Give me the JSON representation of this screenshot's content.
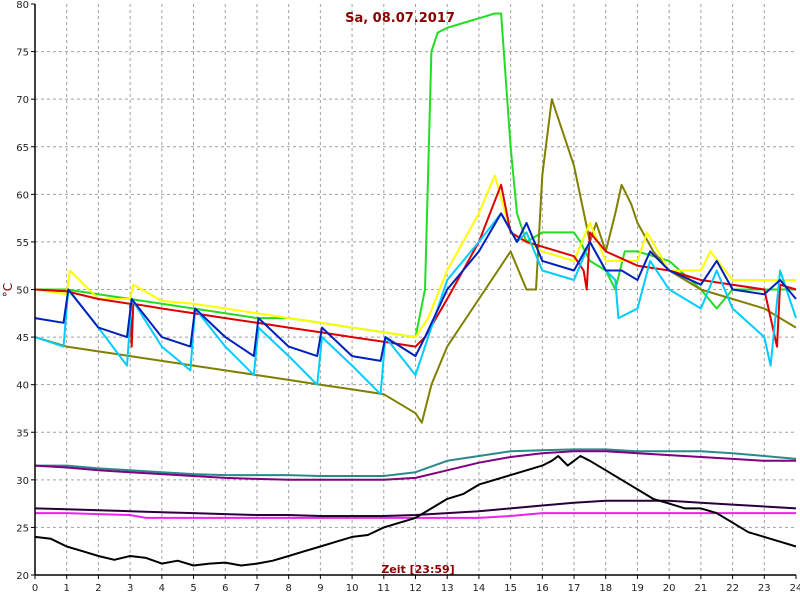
{
  "chart_data": {
    "type": "line",
    "title": "Sa, 08.07.2017",
    "xlabel": "Zeit [23:59]",
    "ylabel": "°C",
    "xlim": [
      0,
      24
    ],
    "ylim": [
      20,
      80
    ],
    "x_ticks": [
      0,
      1,
      2,
      3,
      4,
      5,
      6,
      7,
      8,
      9,
      10,
      11,
      12,
      13,
      14,
      15,
      16,
      17,
      18,
      19,
      20,
      21,
      22,
      23,
      24
    ],
    "y_ticks": [
      20,
      25,
      30,
      35,
      40,
      45,
      50,
      55,
      60,
      65,
      70,
      75,
      80
    ],
    "grid": true,
    "grid_style": "dashed",
    "legend": "none",
    "colors": {
      "background": "#ffffff",
      "grid": "#a0a0a0",
      "axis": "#000000",
      "title": "#8b0000"
    },
    "series": [
      {
        "color": "#22dd22",
        "x": [
          0,
          1,
          2,
          3,
          4,
          5,
          6,
          7,
          8,
          9,
          10,
          11,
          12,
          12.3,
          12.5,
          12.7,
          13,
          13.5,
          14,
          14.5,
          14.7,
          15,
          15.2,
          15.5,
          16,
          17,
          17.2,
          17.5,
          18,
          18.3,
          18.6,
          19,
          20,
          21,
          21.5,
          22,
          23,
          23.5,
          24
        ],
        "y": [
          50,
          50,
          49.5,
          49,
          48.5,
          48,
          47.5,
          47,
          47,
          46.5,
          46,
          45.5,
          45,
          50,
          75,
          77,
          77.5,
          78,
          78.5,
          79,
          79,
          65,
          58,
          55,
          56,
          56,
          55,
          53,
          52,
          50,
          54,
          54,
          53,
          50,
          48,
          50,
          50,
          50,
          50
        ]
      },
      {
        "color": "#808000",
        "x": [
          0,
          1,
          2,
          3,
          4,
          5,
          6,
          7,
          8,
          9,
          10,
          11,
          11.5,
          12,
          12.2,
          12.5,
          13,
          14,
          15,
          15.5,
          15.8,
          16,
          16.3,
          16.7,
          17,
          17.5,
          17.7,
          18,
          18.3,
          18.5,
          18.8,
          19,
          19.5,
          20,
          21,
          22,
          23,
          23.5,
          24
        ],
        "y": [
          45,
          44,
          43.5,
          43,
          42.5,
          42,
          41.5,
          41,
          40.5,
          40,
          39.5,
          39,
          38,
          37,
          36,
          40,
          44,
          49,
          54,
          50,
          50,
          62,
          70,
          66,
          63,
          55,
          57,
          54,
          58,
          61,
          59,
          57,
          54,
          52,
          50,
          49,
          48,
          47,
          46
        ]
      },
      {
        "color": "#ffff00",
        "x": [
          0,
          1,
          1.1,
          2,
          3,
          3.1,
          4,
          5,
          6,
          7,
          8,
          9,
          10,
          11,
          12,
          12.4,
          13,
          14,
          14.5,
          15,
          15.5,
          16,
          17,
          17.5,
          18,
          19,
          19.3,
          20,
          21,
          21.3,
          22,
          23,
          24
        ],
        "y": [
          50,
          49.5,
          52,
          49,
          49,
          50.5,
          48.8,
          48.5,
          48,
          47.5,
          47,
          46.5,
          46,
          45.5,
          45,
          47,
          52,
          58,
          62,
          56,
          55,
          54,
          53,
          57,
          53,
          53,
          56,
          52,
          52,
          54,
          51,
          51,
          51
        ]
      },
      {
        "color": "#dd0000",
        "x": [
          0,
          1,
          2,
          3,
          3.05,
          3.1,
          4,
          5,
          6,
          7,
          8,
          9,
          10,
          11,
          12,
          12.3,
          13,
          14,
          14.7,
          15,
          15.5,
          16,
          17,
          17.3,
          17.4,
          17.5,
          18,
          19,
          20,
          21,
          22,
          23,
          23.4,
          23.5,
          24
        ],
        "y": [
          50,
          49.8,
          49,
          48.5,
          44,
          48.5,
          48,
          47.5,
          47,
          46.5,
          46,
          45.5,
          45,
          44.5,
          44,
          45,
          49,
          55,
          61,
          56,
          55,
          54.5,
          53.5,
          52,
          50,
          56,
          54,
          52.5,
          52,
          51,
          50.5,
          50,
          44,
          50.5,
          50
        ]
      },
      {
        "color": "#00ccff",
        "x": [
          0,
          0.9,
          1.05,
          2,
          2.9,
          3.05,
          4,
          4.9,
          5.05,
          6,
          6.9,
          7.05,
          8,
          8.9,
          9.05,
          10,
          10.9,
          11.05,
          12,
          12.3,
          13,
          14,
          14.7,
          15.2,
          15.5,
          16,
          17,
          17.5,
          18,
          18.3,
          18.4,
          19,
          19.4,
          20,
          21,
          21.5,
          22,
          23,
          23.2,
          23.5,
          24
        ],
        "y": [
          45,
          44,
          50,
          46,
          42,
          49,
          44,
          41.5,
          48,
          44,
          41,
          46,
          43,
          40,
          45,
          42,
          39,
          45,
          41,
          44,
          51,
          55,
          58,
          55,
          56,
          52,
          51,
          55,
          52,
          51,
          47,
          48,
          53,
          50,
          48,
          52,
          48,
          45,
          42,
          52,
          47
        ]
      },
      {
        "color": "#0022bb",
        "x": [
          0,
          0.9,
          1.05,
          2,
          2.9,
          3.05,
          4,
          4.9,
          5.05,
          6,
          6.9,
          7.05,
          8,
          8.9,
          9.05,
          10,
          10.9,
          11.05,
          12,
          12.3,
          13,
          14,
          14.7,
          15.2,
          15.5,
          16,
          17,
          17.5,
          18,
          18.5,
          19,
          19.4,
          20,
          21,
          21.5,
          22,
          23,
          23.5,
          24
        ],
        "y": [
          47,
          46.5,
          50,
          46,
          45,
          49,
          45,
          44,
          48,
          45,
          43,
          47,
          44,
          43,
          46,
          43,
          42.5,
          45,
          43,
          45,
          50,
          54,
          58,
          55,
          57,
          53,
          52,
          55,
          52,
          52,
          51,
          54,
          52,
          50.5,
          53,
          50,
          49.5,
          51,
          49
        ]
      },
      {
        "color": "#2a8a8a",
        "x": [
          0,
          1,
          2,
          3,
          4,
          5,
          6,
          7,
          8,
          9,
          10,
          11,
          12,
          13,
          14,
          15,
          16,
          17,
          18,
          19,
          20,
          21,
          22,
          23,
          24
        ],
        "y": [
          31.5,
          31.5,
          31.2,
          31,
          30.8,
          30.6,
          30.5,
          30.5,
          30.5,
          30.4,
          30.4,
          30.4,
          30.8,
          32,
          32.5,
          33,
          33.1,
          33.2,
          33.2,
          33,
          33,
          33,
          32.8,
          32.5,
          32.2
        ]
      },
      {
        "color": "#800080",
        "x": [
          0,
          1,
          2,
          3,
          4,
          5,
          6,
          7,
          8,
          9,
          10,
          11,
          12,
          13,
          14,
          15,
          16,
          17,
          18,
          19,
          20,
          21,
          22,
          23,
          24
        ],
        "y": [
          31.5,
          31.3,
          31,
          30.8,
          30.6,
          30.4,
          30.2,
          30.1,
          30,
          30,
          30,
          30,
          30.2,
          31,
          31.8,
          32.4,
          32.8,
          33,
          33,
          32.8,
          32.6,
          32.4,
          32.2,
          32,
          32
        ]
      },
      {
        "color": "#ee22ee",
        "x": [
          0,
          1,
          2,
          3,
          3.5,
          4,
          5,
          6,
          7,
          8,
          9,
          10,
          11,
          12,
          13,
          14,
          15,
          16,
          17,
          18,
          19,
          20,
          21,
          22,
          23,
          24
        ],
        "y": [
          26.5,
          26.5,
          26.4,
          26.3,
          26,
          26,
          26,
          26,
          26,
          26,
          26,
          26,
          26,
          26,
          26,
          26,
          26.2,
          26.5,
          26.5,
          26.5,
          26.5,
          26.5,
          26.5,
          26.5,
          26.5,
          26.5
        ]
      },
      {
        "color": "#2a003a",
        "x": [
          0,
          1,
          2,
          3,
          4,
          5,
          6,
          7,
          8,
          9,
          10,
          11,
          12,
          13,
          14,
          15,
          16,
          17,
          18,
          19,
          20,
          21,
          22,
          23,
          24
        ],
        "y": [
          27,
          26.9,
          26.8,
          26.7,
          26.6,
          26.5,
          26.4,
          26.3,
          26.3,
          26.2,
          26.2,
          26.2,
          26.3,
          26.5,
          26.7,
          27,
          27.3,
          27.6,
          27.8,
          27.8,
          27.8,
          27.6,
          27.4,
          27.2,
          27
        ]
      },
      {
        "color": "#000000",
        "x": [
          0,
          0.5,
          1,
          1.5,
          2,
          2.5,
          3,
          3.5,
          4,
          4.5,
          5,
          5.5,
          6,
          6.5,
          7,
          7.5,
          8,
          8.5,
          9,
          9.5,
          10,
          10.5,
          11,
          11.5,
          12,
          12.5,
          13,
          13.5,
          14,
          14.5,
          15,
          15.5,
          16,
          16.3,
          16.5,
          16.8,
          17,
          17.2,
          17.5,
          18,
          18.5,
          19,
          19.5,
          20,
          20.5,
          21,
          21.5,
          22,
          22.5,
          23,
          23.5,
          24
        ],
        "y": [
          24,
          23.8,
          23,
          22.5,
          22,
          21.6,
          22,
          21.8,
          21.2,
          21.5,
          21,
          21.2,
          21.3,
          21,
          21.2,
          21.5,
          22,
          22.5,
          23,
          23.5,
          24,
          24.2,
          25,
          25.5,
          26,
          27,
          28,
          28.5,
          29.5,
          30,
          30.5,
          31,
          31.5,
          32,
          32.5,
          31.5,
          32,
          32.5,
          32,
          31,
          30,
          29,
          28,
          27.5,
          27,
          27,
          26.5,
          25.5,
          24.5,
          24,
          23.5,
          23
        ]
      }
    ]
  }
}
